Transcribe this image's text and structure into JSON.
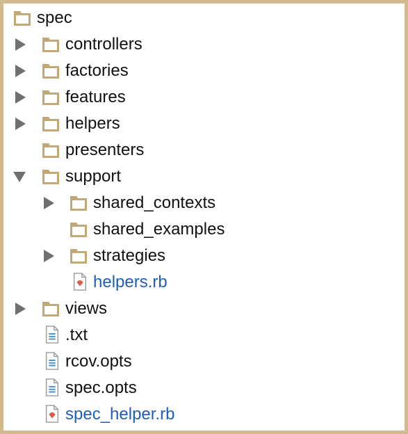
{
  "tree": {
    "root": {
      "label": "spec",
      "icon": "folder-icon"
    },
    "items": [
      {
        "label": "controllers",
        "icon": "folder-icon",
        "state": "collapsed"
      },
      {
        "label": "factories",
        "icon": "folder-icon",
        "state": "collapsed"
      },
      {
        "label": "features",
        "icon": "folder-icon",
        "state": "collapsed"
      },
      {
        "label": "helpers",
        "icon": "folder-icon",
        "state": "collapsed"
      },
      {
        "label": "presenters",
        "icon": "folder-icon",
        "state": "leaf"
      },
      {
        "label": "support",
        "icon": "folder-icon",
        "state": "expanded"
      },
      {
        "label": "shared_contexts",
        "icon": "folder-icon",
        "state": "collapsed"
      },
      {
        "label": "shared_examples",
        "icon": "folder-icon",
        "state": "leaf"
      },
      {
        "label": "strategies",
        "icon": "folder-icon",
        "state": "collapsed"
      },
      {
        "label": "helpers.rb",
        "icon": "ruby-file-icon",
        "state": "leaf"
      },
      {
        "label": "views",
        "icon": "folder-icon",
        "state": "collapsed"
      },
      {
        "label": ".txt",
        "icon": "text-file-icon",
        "state": "leaf"
      },
      {
        "label": "rcov.opts",
        "icon": "text-file-icon",
        "state": "leaf"
      },
      {
        "label": "spec.opts",
        "icon": "text-file-icon",
        "state": "leaf"
      },
      {
        "label": "spec_helper.rb",
        "icon": "ruby-file-icon",
        "state": "leaf"
      }
    ]
  },
  "colors": {
    "frame": "#d2b98f",
    "folder": "#c2a877",
    "arrow": "#707070",
    "text": "#111111",
    "ruby_text": "#1f5fb8",
    "ruby_gem": "#e05a4a",
    "text_file_lines": "#3a8fd0"
  }
}
